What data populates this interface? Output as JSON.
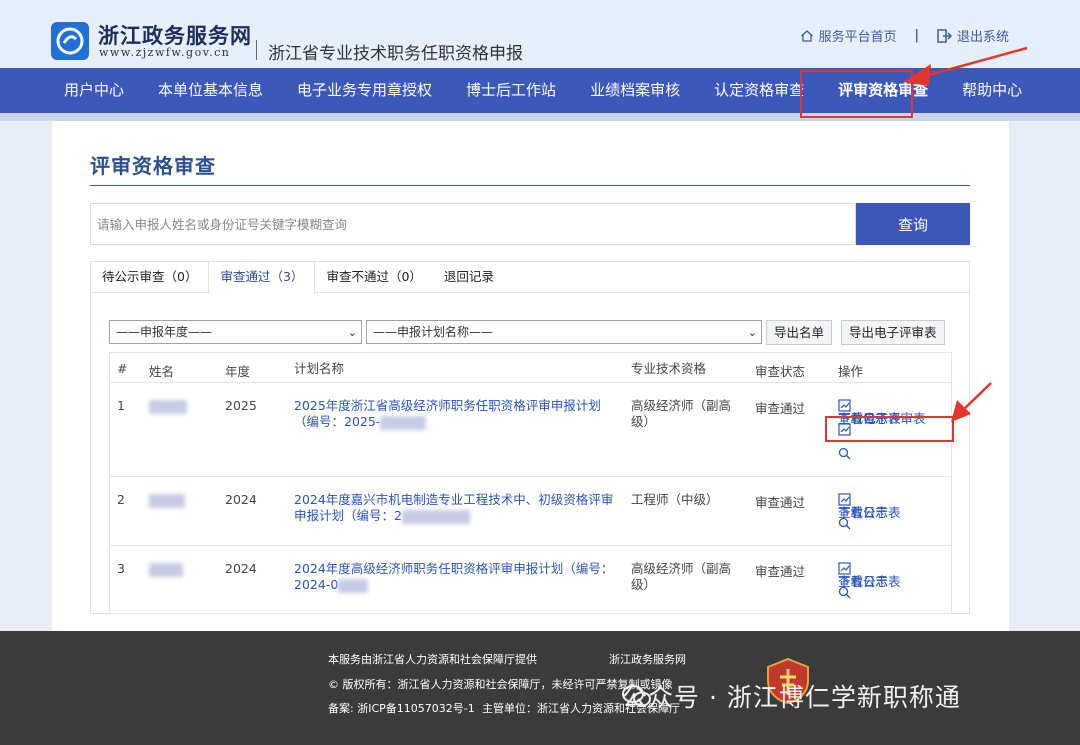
{
  "header": {
    "site_name": "浙江政务服务网",
    "site_url": "www.zjzwfw.gov.cn",
    "system_title": "浙江省专业技术职务任职资格申报",
    "link_home": "服务平台首页",
    "separator": "|",
    "link_logout": "退出系统"
  },
  "nav": {
    "items": [
      "用户中心",
      "本单位基本信息",
      "电子业务专用章授权",
      "博士后工作站",
      "业绩档案审核",
      "认定资格审查",
      "评审资格审查",
      "帮助中心"
    ],
    "active_index": 6
  },
  "page": {
    "title": "评审资格审查",
    "search_placeholder": "请输入申报人姓名或身份证号关键字模糊查询",
    "search_button": "查询"
  },
  "tabs": [
    "待公示审查（0）",
    "审查通过（3）",
    "审查不通过（0）",
    "退回记录"
  ],
  "filters": {
    "year_select": "——申报年度——",
    "plan_select": "——申报计划名称——",
    "export_list": "导出名单",
    "export_form": "导出电子评审表"
  },
  "table": {
    "headers": [
      "#",
      "姓名",
      "年度",
      "计划名称",
      "专业技术资格",
      "审查状态",
      "操作"
    ],
    "rows": [
      {
        "no": "1",
        "year": "2025",
        "plan": "2025年度浙江省高级经济师职务任职资格评审申报计划（编号：2025-",
        "qualification": "高级经济师（副高级）",
        "status": "审查通过",
        "op1": "下载公示表",
        "op2": "下载电子评审表",
        "op3": "查看日志"
      },
      {
        "no": "2",
        "year": "2024",
        "plan": "2024年度嘉兴市机电制造专业工程技术中、初级资格评审申报计划（编号：2",
        "qualification": "工程师（中级）",
        "status": "审查通过",
        "op1": "下载公示表",
        "op3": "查看日志"
      },
      {
        "no": "3",
        "year": "2024",
        "plan": "2024年度高级经济师职务任职资格评审申报计划（编号：2024-0",
        "qualification": "高级经济师（副高级）",
        "status": "审查通过",
        "op1": "下载公示表",
        "op3": "查看日志"
      }
    ]
  },
  "footer": {
    "provider": "本服务由浙江省人力资源和社会保障厅提供",
    "site": "浙江政务服务网",
    "copyright": "© 版权所有：浙江省人力资源和社会保障厅，未经许可严禁复制或镜像",
    "icp": "备案: 浙ICP备11057032号-1",
    "authority": "主管单位：浙江省人力资源和社会保障厅",
    "watermark": "公众号 · 浙江博仁学新职称通"
  },
  "colors": {
    "nav_bg": "#3c58b8",
    "header_bg": "#e6eef9",
    "link": "#2c55b8",
    "annotation_red": "#e5342d",
    "footer_bg": "#3b3b3b"
  }
}
